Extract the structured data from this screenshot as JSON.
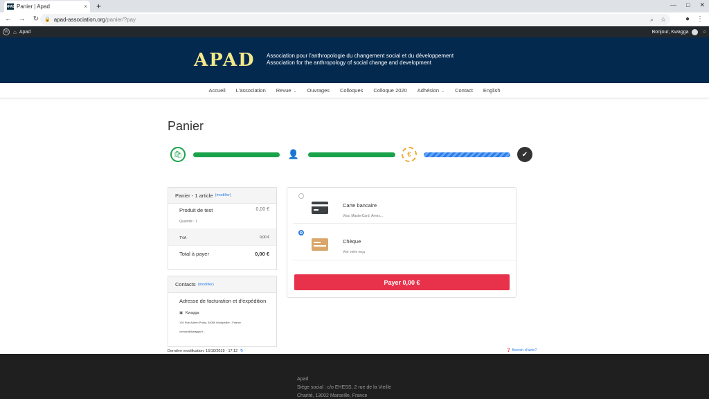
{
  "browser": {
    "tab_title": "Panier | Apad",
    "favicon_text": "APAD",
    "close_glyph": "×",
    "new_tab_glyph": "+",
    "minimize_glyph": "—",
    "maximize_glyph": "□",
    "window_close_glyph": "✕",
    "url_host": "apad-association.org",
    "url_path": "/panier/?pay",
    "back_glyph": "←",
    "forward_glyph": "→",
    "reload_glyph": "↻",
    "lock_glyph": "🔒",
    "zoom_glyph": "⌕",
    "star_glyph": "☆",
    "account_glyph": "●",
    "menu_glyph": "⋮"
  },
  "adminbar": {
    "wp_glyph": "W",
    "home_glyph": "⌂",
    "site_name": "Apad",
    "greeting": "Bonjour, Kwagga",
    "search_glyph": "⌕"
  },
  "header": {
    "logo": "APAD",
    "tagline_fr": "Association pour l'anthropologie du changement social et du développement",
    "tagline_en": "Association for the anthropology of social change and development"
  },
  "nav": {
    "items": [
      "Accueil",
      "L'association",
      "Revue",
      "Ouvrages",
      "Colloques",
      "Colloque 2020",
      "Adhésion",
      "Contact",
      "English"
    ],
    "caret": "⌄"
  },
  "page": {
    "title": "Panier",
    "steps": {
      "cart_glyph": "🛍",
      "account_glyph": "👤",
      "payment_glyph": "€",
      "done_glyph": "✔"
    }
  },
  "cart": {
    "header": "Panier - 1 article",
    "edit": "(modifier)",
    "product": "Produit de test",
    "product_price": "0,00 €",
    "quantity": "Quantité : 1",
    "vat_label": "TVA",
    "vat_value": "0,00 €",
    "total_label": "Total à payer",
    "total_value": "0,00 €"
  },
  "contacts": {
    "header": "Contacts",
    "edit": "(modifier)",
    "address_title": "Adresse de facturation et d'expédition",
    "building_glyph": "▣",
    "name": "Kwagga",
    "address": "120 Rue Adrien Proby, 34080 Montpellier - France",
    "email": "contact@kwagga.fr -"
  },
  "payment": {
    "options": [
      {
        "title": "Carte bancaire",
        "subtitle": "Visa, MasterCard, Amex..."
      },
      {
        "title": "Chèque",
        "subtitle": "Voir votre reçu"
      }
    ],
    "pay_label": "Payer 0,00 €"
  },
  "meta": {
    "last_modified": "Dernière modification: 15/10/2019 - 17:12",
    "refresh_glyph": "↻",
    "help": "❓ Besoin d'aide?"
  },
  "footer": {
    "line1": "Apad",
    "line2": "Siège social : c/o EHESS, 2 rue de la Vieille",
    "line3": "Charité, 13002 Marseille, France"
  },
  "colors": {
    "header_bg": "#03294f",
    "logo": "#f3e98b",
    "step_done": "#1aa34a",
    "step_active": "#2b7de9",
    "pay_button": "#e8324b"
  }
}
